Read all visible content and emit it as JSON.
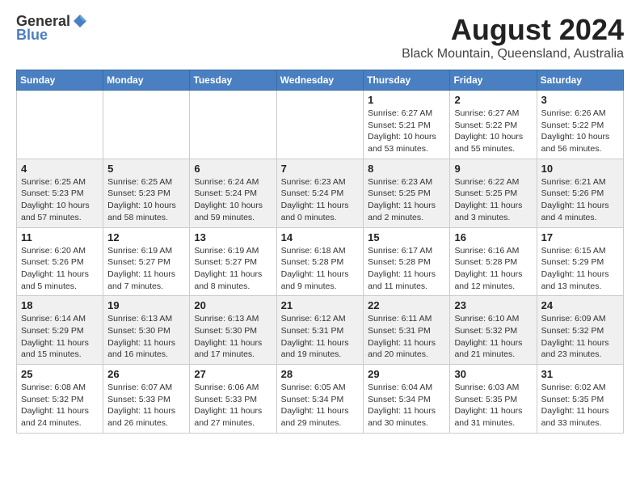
{
  "header": {
    "logo_general": "General",
    "logo_blue": "Blue",
    "title": "August 2024",
    "subtitle": "Black Mountain, Queensland, Australia"
  },
  "weekdays": [
    "Sunday",
    "Monday",
    "Tuesday",
    "Wednesday",
    "Thursday",
    "Friday",
    "Saturday"
  ],
  "weeks": [
    [
      {
        "day": "",
        "info": ""
      },
      {
        "day": "",
        "info": ""
      },
      {
        "day": "",
        "info": ""
      },
      {
        "day": "",
        "info": ""
      },
      {
        "day": "1",
        "info": "Sunrise: 6:27 AM\nSunset: 5:21 PM\nDaylight: 10 hours\nand 53 minutes."
      },
      {
        "day": "2",
        "info": "Sunrise: 6:27 AM\nSunset: 5:22 PM\nDaylight: 10 hours\nand 55 minutes."
      },
      {
        "day": "3",
        "info": "Sunrise: 6:26 AM\nSunset: 5:22 PM\nDaylight: 10 hours\nand 56 minutes."
      }
    ],
    [
      {
        "day": "4",
        "info": "Sunrise: 6:25 AM\nSunset: 5:23 PM\nDaylight: 10 hours\nand 57 minutes."
      },
      {
        "day": "5",
        "info": "Sunrise: 6:25 AM\nSunset: 5:23 PM\nDaylight: 10 hours\nand 58 minutes."
      },
      {
        "day": "6",
        "info": "Sunrise: 6:24 AM\nSunset: 5:24 PM\nDaylight: 10 hours\nand 59 minutes."
      },
      {
        "day": "7",
        "info": "Sunrise: 6:23 AM\nSunset: 5:24 PM\nDaylight: 11 hours\nand 0 minutes."
      },
      {
        "day": "8",
        "info": "Sunrise: 6:23 AM\nSunset: 5:25 PM\nDaylight: 11 hours\nand 2 minutes."
      },
      {
        "day": "9",
        "info": "Sunrise: 6:22 AM\nSunset: 5:25 PM\nDaylight: 11 hours\nand 3 minutes."
      },
      {
        "day": "10",
        "info": "Sunrise: 6:21 AM\nSunset: 5:26 PM\nDaylight: 11 hours\nand 4 minutes."
      }
    ],
    [
      {
        "day": "11",
        "info": "Sunrise: 6:20 AM\nSunset: 5:26 PM\nDaylight: 11 hours\nand 5 minutes."
      },
      {
        "day": "12",
        "info": "Sunrise: 6:19 AM\nSunset: 5:27 PM\nDaylight: 11 hours\nand 7 minutes."
      },
      {
        "day": "13",
        "info": "Sunrise: 6:19 AM\nSunset: 5:27 PM\nDaylight: 11 hours\nand 8 minutes."
      },
      {
        "day": "14",
        "info": "Sunrise: 6:18 AM\nSunset: 5:28 PM\nDaylight: 11 hours\nand 9 minutes."
      },
      {
        "day": "15",
        "info": "Sunrise: 6:17 AM\nSunset: 5:28 PM\nDaylight: 11 hours\nand 11 minutes."
      },
      {
        "day": "16",
        "info": "Sunrise: 6:16 AM\nSunset: 5:28 PM\nDaylight: 11 hours\nand 12 minutes."
      },
      {
        "day": "17",
        "info": "Sunrise: 6:15 AM\nSunset: 5:29 PM\nDaylight: 11 hours\nand 13 minutes."
      }
    ],
    [
      {
        "day": "18",
        "info": "Sunrise: 6:14 AM\nSunset: 5:29 PM\nDaylight: 11 hours\nand 15 minutes."
      },
      {
        "day": "19",
        "info": "Sunrise: 6:13 AM\nSunset: 5:30 PM\nDaylight: 11 hours\nand 16 minutes."
      },
      {
        "day": "20",
        "info": "Sunrise: 6:13 AM\nSunset: 5:30 PM\nDaylight: 11 hours\nand 17 minutes."
      },
      {
        "day": "21",
        "info": "Sunrise: 6:12 AM\nSunset: 5:31 PM\nDaylight: 11 hours\nand 19 minutes."
      },
      {
        "day": "22",
        "info": "Sunrise: 6:11 AM\nSunset: 5:31 PM\nDaylight: 11 hours\nand 20 minutes."
      },
      {
        "day": "23",
        "info": "Sunrise: 6:10 AM\nSunset: 5:32 PM\nDaylight: 11 hours\nand 21 minutes."
      },
      {
        "day": "24",
        "info": "Sunrise: 6:09 AM\nSunset: 5:32 PM\nDaylight: 11 hours\nand 23 minutes."
      }
    ],
    [
      {
        "day": "25",
        "info": "Sunrise: 6:08 AM\nSunset: 5:32 PM\nDaylight: 11 hours\nand 24 minutes."
      },
      {
        "day": "26",
        "info": "Sunrise: 6:07 AM\nSunset: 5:33 PM\nDaylight: 11 hours\nand 26 minutes."
      },
      {
        "day": "27",
        "info": "Sunrise: 6:06 AM\nSunset: 5:33 PM\nDaylight: 11 hours\nand 27 minutes."
      },
      {
        "day": "28",
        "info": "Sunrise: 6:05 AM\nSunset: 5:34 PM\nDaylight: 11 hours\nand 29 minutes."
      },
      {
        "day": "29",
        "info": "Sunrise: 6:04 AM\nSunset: 5:34 PM\nDaylight: 11 hours\nand 30 minutes."
      },
      {
        "day": "30",
        "info": "Sunrise: 6:03 AM\nSunset: 5:35 PM\nDaylight: 11 hours\nand 31 minutes."
      },
      {
        "day": "31",
        "info": "Sunrise: 6:02 AM\nSunset: 5:35 PM\nDaylight: 11 hours\nand 33 minutes."
      }
    ]
  ]
}
